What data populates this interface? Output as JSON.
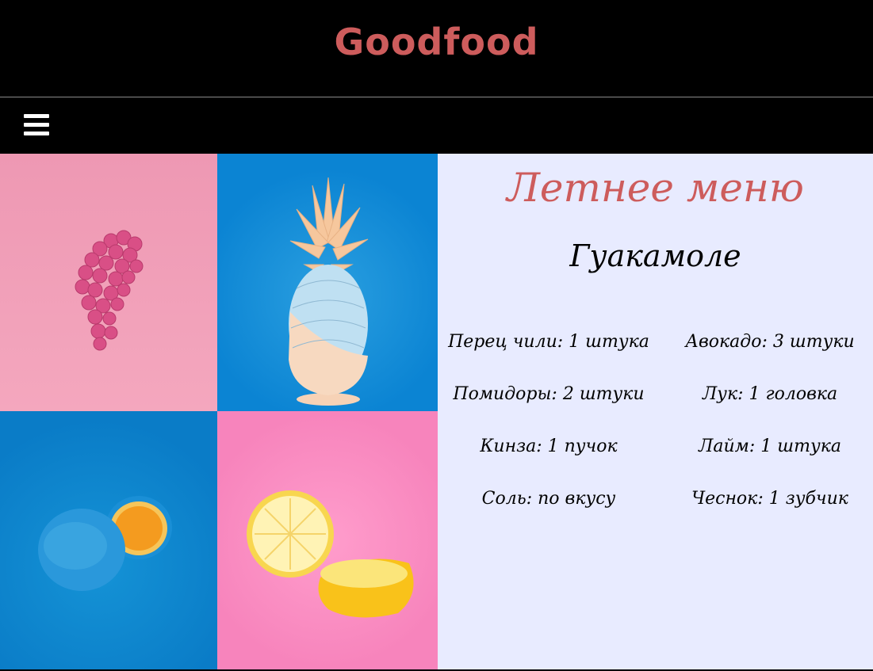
{
  "header": {
    "logo": "Goodfood",
    "logo_color": "#cd5c5c"
  },
  "nav": {
    "menu_icon": "hamburger-menu-icon"
  },
  "gallery": {
    "images": [
      {
        "name": "pink-grapes-image",
        "background": "#f2a1b9"
      },
      {
        "name": "pineapple-image",
        "background": "#0b84d3"
      },
      {
        "name": "blue-orange-image",
        "background": "#0a7cc7"
      },
      {
        "name": "lemon-image",
        "background": "#f98ec4"
      }
    ]
  },
  "menu": {
    "title": "Летнее меню",
    "title_color": "#cd5c5c",
    "recipe": "Гуакамоле",
    "background": "#e8ebff",
    "ingredients": [
      "Перец чили: 1 штука",
      "Авокадо: 3 штуки",
      "Помидоры: 2 штуки",
      "Лук: 1 головка",
      "Кинза: 1 пучок",
      "Лайм: 1 штука",
      "Соль: по вкусу",
      "Чеснок: 1 зубчик"
    ]
  }
}
